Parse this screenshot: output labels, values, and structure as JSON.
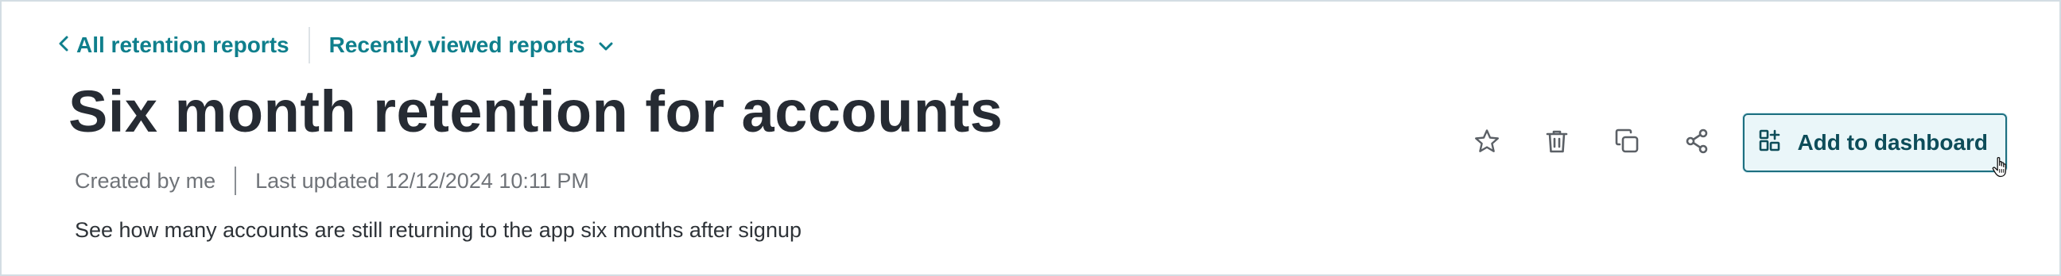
{
  "breadcrumb": {
    "back_label": "All retention reports",
    "recent_label": "Recently viewed reports"
  },
  "report": {
    "title": "Six month retention for accounts",
    "created_by": "Created by me",
    "last_updated": "Last updated 12/12/2024 10:11 PM",
    "description": "See how many accounts are still returning to the app six months after signup"
  },
  "actions": {
    "icons": [
      "star-icon",
      "trash-icon",
      "copy-icon",
      "share-icon"
    ],
    "add_label": "Add to dashboard"
  },
  "colors": {
    "link": "#0f7f8c",
    "title": "#262b33",
    "muted": "#6f7378",
    "button_border": "#1d6f80",
    "button_bg": "#eaf6f9"
  }
}
